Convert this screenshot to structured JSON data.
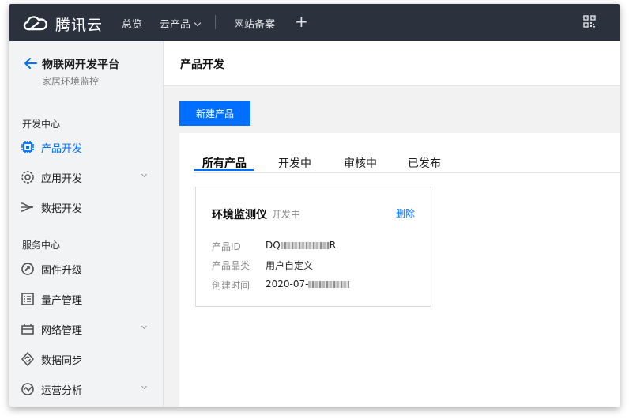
{
  "topbar": {
    "brand": "腾讯云",
    "nav": [
      {
        "label": "总览"
      },
      {
        "label": "云产品"
      },
      {
        "label": "网站备案"
      }
    ]
  },
  "sidebar": {
    "title": "物联网开发平台",
    "subtitle": "家居环境监控",
    "sections": [
      {
        "label": "开发中心"
      },
      {
        "label": "服务中心"
      }
    ],
    "items": [
      {
        "label": "产品开发",
        "icon": "chip-icon"
      },
      {
        "label": "应用开发",
        "icon": "app-icon"
      },
      {
        "label": "数据开发",
        "icon": "data-flow-icon"
      },
      {
        "label": "固件升级",
        "icon": "firmware-icon"
      },
      {
        "label": "量产管理",
        "icon": "list-icon"
      },
      {
        "label": "网络管理",
        "icon": "network-icon"
      },
      {
        "label": "数据同步",
        "icon": "sync-icon"
      },
      {
        "label": "运营分析",
        "icon": "analytics-icon"
      }
    ]
  },
  "main": {
    "title": "产品开发",
    "new_button": "新建产品",
    "tabs": [
      {
        "label": "所有产品"
      },
      {
        "label": "开发中"
      },
      {
        "label": "审核中"
      },
      {
        "label": "已发布"
      }
    ],
    "card": {
      "name": "环境监测仪",
      "status": "开发中",
      "delete": "删除",
      "fields": [
        {
          "key": "产品ID",
          "value_prefix": "DQ",
          "value_suffix": "R"
        },
        {
          "key": "产品品类",
          "value": "用户自定义"
        },
        {
          "key": "创建时间",
          "value_prefix": "2020-07-",
          "value_suffix": ""
        }
      ]
    }
  },
  "colors": {
    "topbar": "#2b313d",
    "accent": "#006eff",
    "sidebar_bg": "#f2f3f5",
    "page_bg": "#f2f2f2"
  }
}
